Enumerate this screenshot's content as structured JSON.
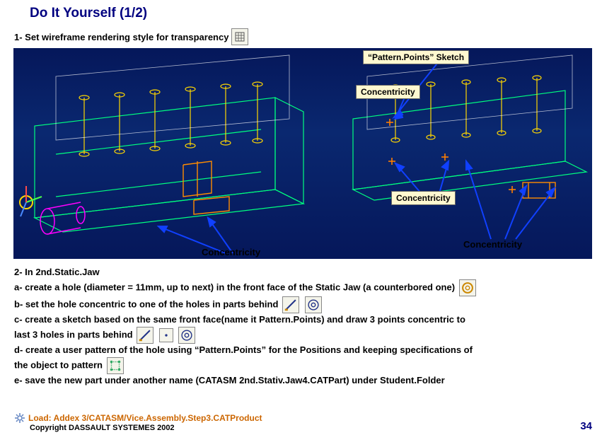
{
  "title": "Do It Yourself (1/2)",
  "step1_text": "1- Set wireframe rendering style for transparency",
  "labels": {
    "pattern_points": "“Pattern.Points” Sketch",
    "concentricity": "Concentricity"
  },
  "step2": {
    "header": "2- In 2nd.Static.Jaw",
    "a1": "a- create a hole (diameter = 11mm, up to next) in the front face of the Static Jaw (a counterbored one)",
    "b1": "b- set the hole concentric to one of the holes in parts behind",
    "c1": "c- create a sketch based on the same front face(name it Pattern.Points) and draw 3 points concentric to",
    "c2": "last 3 holes in parts behind",
    "d1": "d- create a user pattern of the hole using “Pattern.Points” for the Positions and keeping specifications of",
    "d2": "the object to pattern",
    "e1": "e- save the new part under another name (CATASM 2nd.Stativ.Jaw4.CATPart) under Student.Folder"
  },
  "load_text": "Load: Addex 3/CATASM/Vice.Assembly.Step3.CATProduct",
  "copyright": "Copyright DASSAULT SYSTEMES 2002",
  "page": "34"
}
